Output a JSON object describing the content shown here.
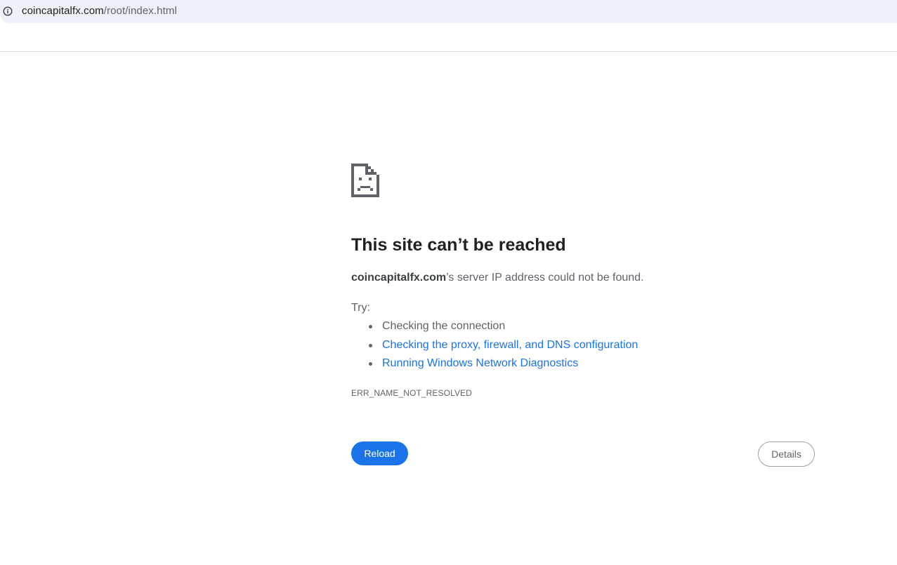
{
  "address_bar": {
    "icon": "info-icon",
    "url_host": "coincapitalfx.com",
    "url_path": "/root/index.html"
  },
  "error_page": {
    "icon": "sad-page-icon",
    "title": "This site can’t be reached",
    "message_host": "coincapitalfx.com",
    "message_rest": "’s server IP address could not be found.",
    "try_label": "Try:",
    "suggestions": [
      {
        "text": "Checking the connection",
        "is_link": false
      },
      {
        "text": "Checking the proxy, firewall, and DNS configuration",
        "is_link": true
      },
      {
        "text": "Running Windows Network Diagnostics",
        "is_link": true
      }
    ],
    "error_code": "ERR_NAME_NOT_RESOLVED"
  },
  "buttons": {
    "reload_label": "Reload",
    "details_label": "Details"
  },
  "colors": {
    "accent": "#1a73e8",
    "title": "#202124",
    "secondary_text": "#5f6368",
    "address_bar_bg": "#eef1f8"
  }
}
